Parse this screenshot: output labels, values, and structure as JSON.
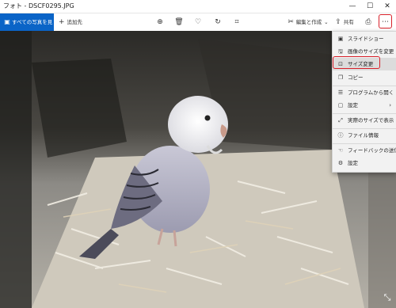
{
  "window": {
    "title": "フォト - DSCF0295.JPG",
    "minimize": "—",
    "maximize": "☐",
    "close": "✕"
  },
  "toolbar": {
    "all_photos_label": "すべての写真を見る",
    "add_to_label": "追加先",
    "zoom_icon": "⊕",
    "delete_icon": "🗑",
    "favorite_icon": "♡",
    "rotate_icon": "↻",
    "crop_icon": "⌗",
    "edit_create_label": "編集と作成",
    "share_label": "共有",
    "print_icon": "⎙",
    "more_icon": "⋯"
  },
  "menu": {
    "items": [
      {
        "icon": "▣",
        "label": "スライドショー"
      },
      {
        "icon": "🖫",
        "label": "画像のサイズを変更"
      },
      {
        "icon": "⊡",
        "label": "サイズ変更"
      },
      {
        "icon": "❐",
        "label": "コピー"
      },
      {
        "icon": "☰",
        "label": "プログラムから開く"
      },
      {
        "icon": "▢",
        "label": "設定",
        "has_submenu": true
      },
      {
        "icon": "⤢",
        "label": "実際のサイズで表示"
      },
      {
        "icon": "ⓘ",
        "label": "ファイル情報"
      },
      {
        "icon": "☜",
        "label": "フィードバックの送信"
      },
      {
        "icon": "⚙",
        "label": "設定"
      }
    ]
  },
  "colors": {
    "accent": "#0a64c7",
    "highlight_border": "#d8202a"
  }
}
